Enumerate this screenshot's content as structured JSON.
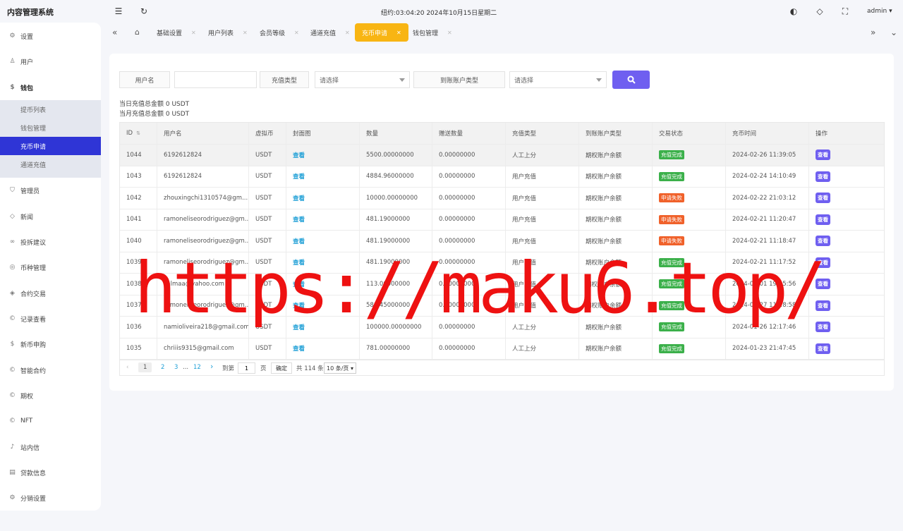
{
  "app": {
    "title": "内容管理系统",
    "clock": "纽约:03:04:20 2024年10月15日星期二",
    "user": "admin"
  },
  "sidebar": {
    "items": [
      {
        "label": "设置",
        "icon": "gear-icon"
      },
      {
        "label": "用户",
        "icon": "user-icon"
      },
      {
        "label": "钱包",
        "icon": "wallet-icon"
      },
      {
        "label": "管理员",
        "icon": "shield-icon"
      },
      {
        "label": "新闻",
        "icon": "tag-icon"
      },
      {
        "label": "投拆建议",
        "icon": "link-icon"
      },
      {
        "label": "币种管理",
        "icon": "coin-icon"
      },
      {
        "label": "合约交易",
        "icon": "diamond-icon"
      },
      {
        "label": "记录查看",
        "icon": "record-icon"
      },
      {
        "label": "新币申购",
        "icon": "coin-icon"
      },
      {
        "label": "智能合约",
        "icon": "contract-icon"
      },
      {
        "label": "期权",
        "icon": "option-icon"
      },
      {
        "label": "NFT",
        "icon": "nft-icon"
      },
      {
        "label": "站内信",
        "icon": "bell-icon"
      },
      {
        "label": "贷款信息",
        "icon": "loan-icon"
      },
      {
        "label": "分销设置",
        "icon": "gear-icon"
      }
    ],
    "wallet_sub": [
      "提币列表",
      "钱包管理",
      "充币申请",
      "通道充值"
    ]
  },
  "tabs": [
    "基础设置",
    "用户列表",
    "会员等级",
    "通道充值",
    "充币申请",
    "钱包管理"
  ],
  "filters": {
    "username_label": "用户名",
    "recharge_type_label": "充值类型",
    "recharge_type_value": "请选择",
    "account_type_label": "到账账户类型",
    "account_type_value": "请选择"
  },
  "summary": {
    "today": "当日充值总金额 0 USDT",
    "month": "当月充值总金额 0 USDT"
  },
  "table": {
    "headers": [
      "ID",
      "用户名",
      "虚拟币",
      "封面图",
      "数量",
      "赠送数量",
      "充值类型",
      "到账账户类型",
      "交易状态",
      "充币时间",
      "操作"
    ],
    "rows": [
      {
        "id": "1044",
        "user": "6192612824",
        "coin": "USDT",
        "cover": "查看",
        "qty": "5500.00000000",
        "gift": "0.00000000",
        "type": "人工上分",
        "account": "期权账户余额",
        "status": "充值完成",
        "ok": true,
        "time": "2024-02-26 11:39:05",
        "op": "查看"
      },
      {
        "id": "1043",
        "user": "6192612824",
        "coin": "USDT",
        "cover": "查看",
        "qty": "4884.96000000",
        "gift": "0.00000000",
        "type": "用户充值",
        "account": "期权账户余额",
        "status": "充值完成",
        "ok": true,
        "time": "2024-02-24 14:10:49",
        "op": "查看"
      },
      {
        "id": "1042",
        "user": "zhouxingchi1310574@gm...",
        "coin": "USDT",
        "cover": "查看",
        "qty": "10000.00000000",
        "gift": "0.00000000",
        "type": "用户充值",
        "account": "期权账户余额",
        "status": "申请失败",
        "ok": false,
        "time": "2024-02-22 21:03:12",
        "op": "查看"
      },
      {
        "id": "1041",
        "user": "ramoneliseorodriguez@gm...",
        "coin": "USDT",
        "cover": "查看",
        "qty": "481.19000000",
        "gift": "0.00000000",
        "type": "用户充值",
        "account": "期权账户余额",
        "status": "申请失败",
        "ok": false,
        "time": "2024-02-21 11:20:47",
        "op": "查看"
      },
      {
        "id": "1040",
        "user": "ramoneliseorodriguez@gm...",
        "coin": "USDT",
        "cover": "查看",
        "qty": "481.19000000",
        "gift": "0.00000000",
        "type": "用户充值",
        "account": "期权账户余额",
        "status": "申请失败",
        "ok": false,
        "time": "2024-02-21 11:18:47",
        "op": "查看"
      },
      {
        "id": "1039",
        "user": "ramoneliseorodriguez@gm...",
        "coin": "USDT",
        "cover": "查看",
        "qty": "481.19000000",
        "gift": "0.00000000",
        "type": "用户充值",
        "account": "期权账户余额",
        "status": "充值完成",
        "ok": true,
        "time": "2024-02-21 11:17:52",
        "op": "查看"
      },
      {
        "id": "1038",
        "user": "salmaa@yahoo.com",
        "coin": "USDT",
        "cover": "查看",
        "qty": "113.00000000",
        "gift": "0.00000000",
        "type": "用户充值",
        "account": "期权账户余额",
        "status": "充值完成",
        "ok": true,
        "time": "2024-02-01 19:25:56",
        "op": "查看"
      },
      {
        "id": "1037",
        "user": "ramoneliseorodriguez@gm...",
        "coin": "USDT",
        "cover": "查看",
        "qty": "588.45000000",
        "gift": "0.00000000",
        "type": "用户充值",
        "account": "期权账户余额",
        "status": "充值完成",
        "ok": true,
        "time": "2024-01-27 11:28:58",
        "op": "查看"
      },
      {
        "id": "1036",
        "user": "namioliveira218@gmail.com",
        "coin": "USDT",
        "cover": "查看",
        "qty": "100000.00000000",
        "gift": "0.00000000",
        "type": "人工上分",
        "account": "期权账户余额",
        "status": "充值完成",
        "ok": true,
        "time": "2024-01-26 12:17:46",
        "op": "查看"
      },
      {
        "id": "1035",
        "user": "chriiis9315@gmail.com",
        "coin": "USDT",
        "cover": "查看",
        "qty": "781.00000000",
        "gift": "0.00000000",
        "type": "人工上分",
        "account": "期权账户余额",
        "status": "充值完成",
        "ok": true,
        "time": "2024-01-23 21:47:45",
        "op": "查看"
      }
    ]
  },
  "pager": {
    "pages": [
      "1",
      "2",
      "3",
      "...",
      "12"
    ],
    "goto_label": "到第",
    "goto_value": "1",
    "page_unit": "页",
    "confirm": "确定",
    "total": "共 114 条",
    "page_size": "10 条/页"
  },
  "watermark": "https://maku6.top/",
  "colors": {
    "accent": "#6f5ff0",
    "active_nav": "#2f35d6",
    "active_tab": "#f8b513",
    "success": "#3bb04a",
    "fail": "#f0612a",
    "link": "#1e9fd6"
  }
}
